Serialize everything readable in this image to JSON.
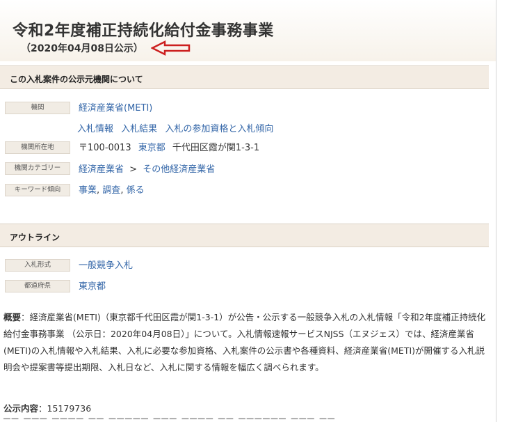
{
  "header": {
    "title": "令和2年度補正持続化給付金事務事業",
    "pubdate": "（2020年04月08日公示）"
  },
  "org_section": {
    "heading": "この入札案件の公示元機関について",
    "agency_label": "機関",
    "agency_name": "経済産業省(METI)",
    "agency_links": [
      "入札情報",
      "入札結果",
      "入札の参加資格と入札傾向"
    ],
    "address_label": "機関所在地",
    "address_postal": "〒100-0013",
    "address_pref": "東京都",
    "address_rest": "千代田区霞が関1-3-1",
    "category_label": "機関カテゴリー",
    "category_parent": "経済産業省",
    "category_sep": ">",
    "category_child": "その他経済産業省",
    "keyword_label": "キーワード傾向",
    "keywords": [
      "事業",
      "調査",
      "係る"
    ],
    "keyword_sep": ","
  },
  "outline_section": {
    "heading": "アウトライン",
    "form_label": "入札形式",
    "form_value": "一般競争入札",
    "pref_label": "都道府県",
    "pref_value": "東京都"
  },
  "summary": {
    "label": "概要",
    "colon": "：",
    "text": "経済産業省(METI)（東京都千代田区霞が関1-3-1）が公告・公示する一般競争入札の入札情報「令和2年度補正持続化給付金事務事業 （公示日：2020年04月08日）」について。入札情報速報サービスNJSS（エヌジェス）では、経済産業省(METI)の入札情報や入札結果、入札に必要な参加資格、入札案件の公示書や各種資料、経済産業省(METI)が開催する入札説明会や提案書等提出期限、入札日など、入札に関する情報を幅広く調べられます。"
  },
  "notice": {
    "label": "公示内容",
    "colon": "：",
    "value": "15179736"
  },
  "colors": {
    "link": "#3366a8",
    "section_bg": "#f3ece3",
    "label_bg": "#f1ece4",
    "arrow": "#cc1f1f"
  },
  "icons": {
    "pointer_arrow": "left-arrow-icon"
  }
}
